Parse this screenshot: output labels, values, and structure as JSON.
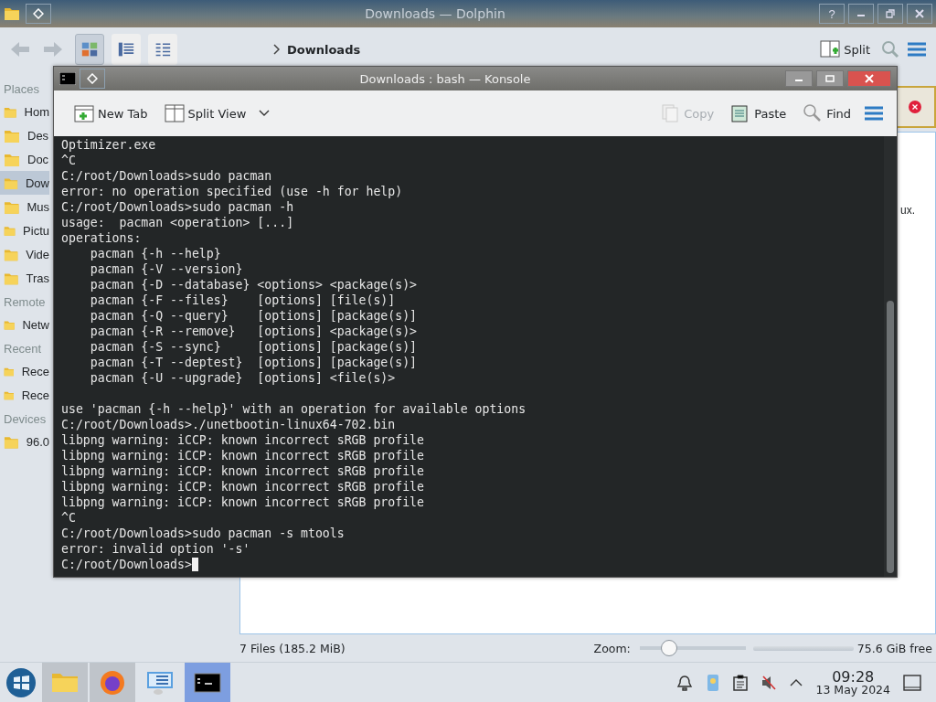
{
  "dolphin": {
    "title": "Downloads — Dolphin",
    "help_button": "?",
    "view_modes": [
      {
        "selected": true
      },
      {
        "selected": false
      },
      {
        "selected": false
      }
    ],
    "breadcrumb": "Downloads",
    "split_button": "Split",
    "sidebar": [
      {
        "heading": "Places",
        "items": [
          {
            "label": "Hom",
            "selected": false
          },
          {
            "label": "Des",
            "selected": false
          },
          {
            "label": "Doc",
            "selected": false
          },
          {
            "label": "Dow",
            "selected": true
          },
          {
            "label": "Mus",
            "selected": false
          },
          {
            "label": "Pictu",
            "selected": false
          },
          {
            "label": "Vide",
            "selected": false
          },
          {
            "label": "Tras",
            "selected": false
          }
        ]
      },
      {
        "heading": "Remote",
        "items": [
          {
            "label": "Netw",
            "selected": false
          }
        ]
      },
      {
        "heading": "Recent",
        "items": [
          {
            "label": "Rece",
            "selected": false
          },
          {
            "label": "Rece",
            "selected": false
          }
        ]
      },
      {
        "heading": "Devices",
        "items": [
          {
            "label": "96.0",
            "selected": false
          }
        ]
      }
    ],
    "view_text": "ux.",
    "status": {
      "files": "7 Files (185.2 MiB)",
      "zoom_label": "Zoom:",
      "zoom": {
        "level": 0.28
      },
      "free": "75.6 GiB free"
    }
  },
  "konsole": {
    "title": "Downloads : bash — Konsole",
    "toolbar": [
      {
        "label": "New Tab",
        "kind": "newtab",
        "disabled": false
      },
      {
        "label": "Split View",
        "kind": "split",
        "disabled": false
      },
      {
        "label": "Copy",
        "kind": "copy",
        "disabled": true
      },
      {
        "label": "Paste",
        "kind": "paste",
        "disabled": false
      },
      {
        "label": "Find",
        "kind": "find",
        "disabled": false
      }
    ],
    "blocks": [
      [
        "Optimizer.exe",
        "^C",
        "C:/root/Downloads>sudo pacman",
        "error: no operation specified (use -h for help)",
        "C:/root/Downloads>sudo pacman -h",
        "usage:  pacman <operation> [...]",
        "operations:",
        "    pacman {-h --help}",
        "    pacman {-V --version}",
        "    pacman {-D --database} <options> <package(s)>",
        "    pacman {-F --files}    [options] [file(s)]",
        "    pacman {-Q --query}    [options] [package(s)]",
        "    pacman {-R --remove}   [options] <package(s)>",
        "    pacman {-S --sync}     [options] [package(s)]",
        "    pacman {-T --deptest}  [options] [package(s)]",
        "    pacman {-U --upgrade}  [options] <file(s)>"
      ],
      [
        "use 'pacman {-h --help}' with an operation for available options",
        "C:/root/Downloads>./unetbootin-linux64-702.bin",
        "libpng warning: iCCP: known incorrect sRGB profile",
        "libpng warning: iCCP: known incorrect sRGB profile",
        "libpng warning: iCCP: known incorrect sRGB profile",
        "libpng warning: iCCP: known incorrect sRGB profile",
        "libpng warning: iCCP: known incorrect sRGB profile",
        "^C",
        "C:/root/Downloads>sudo pacman -s mtools",
        "error: invalid option '-s'",
        "C:/root/Downloads>"
      ]
    ],
    "cursor": true
  },
  "taskbar": {
    "tasks": [
      {
        "open": true,
        "selected": false
      },
      {
        "open": true,
        "selected": false
      },
      {
        "open": false,
        "selected": false
      },
      {
        "open": true,
        "selected": true
      }
    ],
    "clock": {
      "time": "09:28",
      "date": "13 May 2024"
    }
  }
}
